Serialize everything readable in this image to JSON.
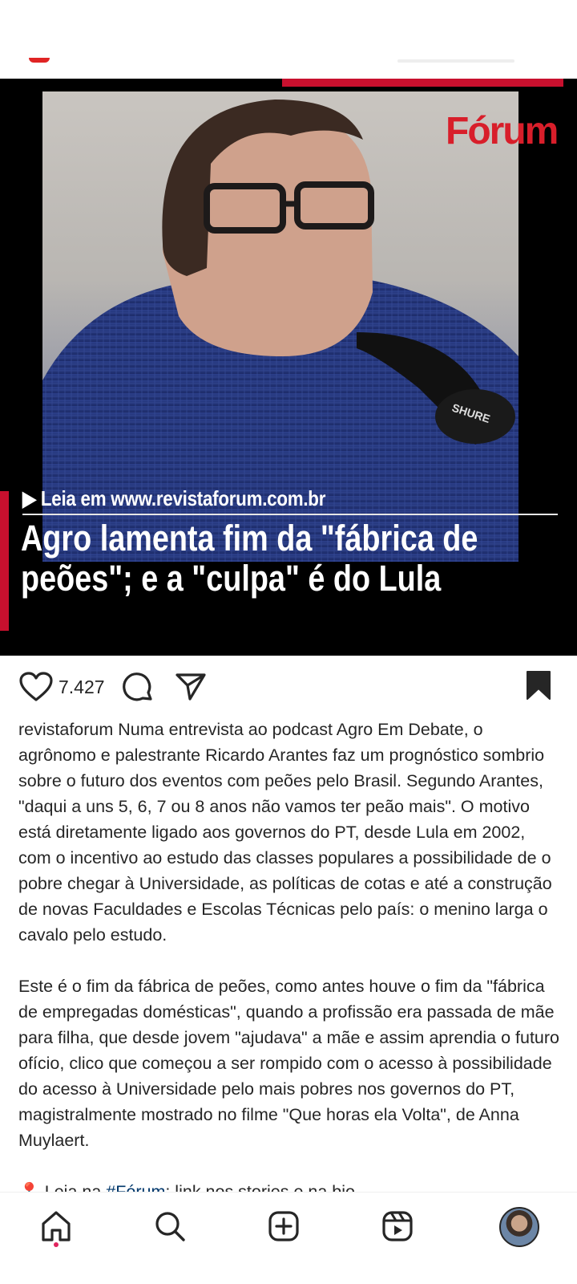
{
  "post": {
    "image": {
      "logo_text": "Fórum",
      "read_more": "▶ Leia em www.revistaforum.com.br",
      "headline": "Agro lamenta fim da \"fábrica de peões\"; e a \"culpa\" é do Lula"
    },
    "actions": {
      "like_icon": "heart-icon",
      "like_count": "7.427",
      "comment_icon": "comment-icon",
      "share_icon": "send-icon",
      "save_icon": "bookmark-icon"
    },
    "caption": {
      "username": "revistaforum",
      "paragraph_1": "Numa entrevista ao podcast Agro Em Debate, o agrônomo e palestrante Ricardo Arantes faz um prognóstico sombrio sobre o futuro dos eventos com peões pelo Brasil. Segundo Arantes, \"daqui a uns 5, 6, 7 ou 8 anos não vamos ter peão mais\". O motivo está diretamente ligado aos governos do PT, desde Lula em 2002, com o incentivo ao estudo das classes populares a possibilidade de o pobre chegar à Universidade, as políticas de cotas e até a construção de novas Faculdades e Escolas Técnicas pelo país: o menino larga o cavalo pelo estudo.",
      "paragraph_2": "Este é o fim da fábrica de peões, como antes houve o fim da \"fábrica de empregadas domésticas\", quando a profissão era passada de mãe para filha, que desde jovem \"ajudava\" a mãe e assim aprendia o futuro ofício, clico que começou a ser rompido com o acesso à possibilidade do acesso à Universidade pelo mais pobres nos governos do PT, magistralmente mostrado no filme \"Que horas ela Volta\", de Anna Muylaert.",
      "tail_pin": "📍",
      "tail_prefix": "Leia na ",
      "tail_tag": "#Fórum",
      "tail_suffix": ": link nos stories e na bio"
    }
  },
  "bottom_nav": {
    "items": [
      {
        "name": "home",
        "icon": "home-icon",
        "active": true
      },
      {
        "name": "search",
        "icon": "search-icon"
      },
      {
        "name": "create",
        "icon": "plus-square-icon"
      },
      {
        "name": "reels",
        "icon": "reels-icon"
      },
      {
        "name": "profile",
        "icon": "avatar"
      }
    ]
  },
  "colors": {
    "brand_red": "#c8102e",
    "text": "#262626",
    "hashtag": "#00376b",
    "notification_dot": "#e0245e"
  }
}
